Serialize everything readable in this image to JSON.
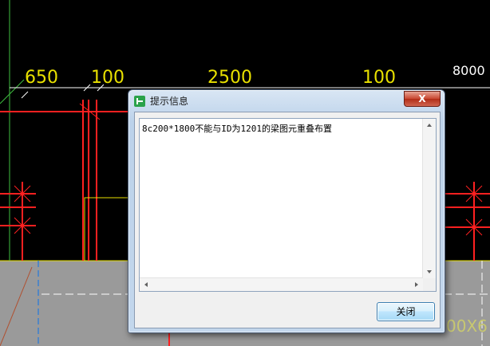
{
  "drawing": {
    "dimensions": [
      "650",
      "100",
      "2500",
      "100"
    ],
    "dim_right": "8000",
    "bottom_text": "00X6",
    "colors": {
      "background": "#000000",
      "dimension_text": "#e8e000",
      "rebar": "#ff0000",
      "gray_panel": "#999999"
    }
  },
  "dialog": {
    "title": "提示信息",
    "title_icon": "app-icon",
    "close_glyph": "X",
    "message": "8c200*1800不能与ID为1201的梁图元重叠布置",
    "close_button_label": "关闭"
  }
}
